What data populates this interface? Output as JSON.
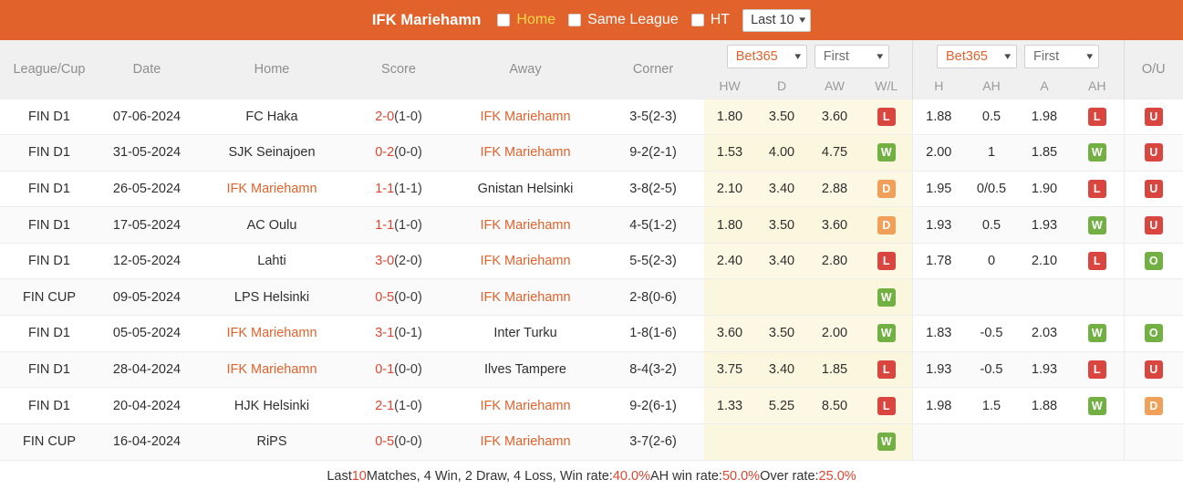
{
  "topbar": {
    "team_title": "IFK Mariehamn",
    "filters": [
      {
        "label": "Home",
        "checked": false,
        "active": true
      },
      {
        "label": "Same League",
        "checked": false,
        "active": false
      },
      {
        "label": "HT",
        "checked": false,
        "active": false
      }
    ],
    "range_select": {
      "value": "Last 10",
      "caret": "chevron-down-icon"
    }
  },
  "table": {
    "headers": {
      "league": "League/Cup",
      "date": "Date",
      "home": "Home",
      "score": "Score",
      "away": "Away",
      "corner": "Corner",
      "ou": "O/U"
    },
    "odds_group_1": {
      "bookmaker": "Bet365",
      "period": "First",
      "sub": [
        "HW",
        "D",
        "AW",
        "W/L"
      ]
    },
    "odds_group_2": {
      "bookmaker": "Bet365",
      "period": "First",
      "sub": [
        "H",
        "AH",
        "A",
        "AH"
      ]
    },
    "rows": [
      {
        "league": "FIN D1",
        "date": "07-06-2024",
        "home": "FC Haka",
        "home_hl": false,
        "score_main": "2-0",
        "score_ht": "(1-0)",
        "away": "IFK Mariehamn",
        "away_hl": true,
        "corner": "3-5(2-3)",
        "hw": "1.80",
        "d": "3.50",
        "aw": "3.60",
        "wl": "L",
        "h": "1.88",
        "ah1": "0.5",
        "a": "1.98",
        "ah2": "L",
        "ou": "U"
      },
      {
        "league": "FIN D1",
        "date": "31-05-2024",
        "home": "SJK Seinajoen",
        "home_hl": false,
        "score_main": "0-2",
        "score_ht": "(0-0)",
        "away": "IFK Mariehamn",
        "away_hl": true,
        "corner": "9-2(2-1)",
        "hw": "1.53",
        "d": "4.00",
        "aw": "4.75",
        "wl": "W",
        "h": "2.00",
        "ah1": "1",
        "a": "1.85",
        "ah2": "W",
        "ou": "U"
      },
      {
        "league": "FIN D1",
        "date": "26-05-2024",
        "home": "IFK Mariehamn",
        "home_hl": true,
        "score_main": "1-1",
        "score_ht": "(1-1)",
        "away": "Gnistan Helsinki",
        "away_hl": false,
        "corner": "3-8(2-5)",
        "hw": "2.10",
        "d": "3.40",
        "aw": "2.88",
        "wl": "D",
        "h": "1.95",
        "ah1": "0/0.5",
        "a": "1.90",
        "ah2": "L",
        "ou": "U"
      },
      {
        "league": "FIN D1",
        "date": "17-05-2024",
        "home": "AC Oulu",
        "home_hl": false,
        "score_main": "1-1",
        "score_ht": "(1-0)",
        "away": "IFK Mariehamn",
        "away_hl": true,
        "corner": "4-5(1-2)",
        "hw": "1.80",
        "d": "3.50",
        "aw": "3.60",
        "wl": "D",
        "h": "1.93",
        "ah1": "0.5",
        "a": "1.93",
        "ah2": "W",
        "ou": "U"
      },
      {
        "league": "FIN D1",
        "date": "12-05-2024",
        "home": "Lahti",
        "home_hl": false,
        "score_main": "3-0",
        "score_ht": "(2-0)",
        "away": "IFK Mariehamn",
        "away_hl": true,
        "corner": "5-5(2-3)",
        "hw": "2.40",
        "d": "3.40",
        "aw": "2.80",
        "wl": "L",
        "h": "1.78",
        "ah1": "0",
        "a": "2.10",
        "ah2": "L",
        "ou": "O"
      },
      {
        "league": "FIN CUP",
        "date": "09-05-2024",
        "home": "LPS Helsinki",
        "home_hl": false,
        "score_main": "0-5",
        "score_ht": "(0-0)",
        "away": "IFK Mariehamn",
        "away_hl": true,
        "corner": "2-8(0-6)",
        "hw": "",
        "d": "",
        "aw": "",
        "wl": "W",
        "h": "",
        "ah1": "",
        "a": "",
        "ah2": "",
        "ou": ""
      },
      {
        "league": "FIN D1",
        "date": "05-05-2024",
        "home": "IFK Mariehamn",
        "home_hl": true,
        "score_main": "3-1",
        "score_ht": "(0-1)",
        "away": "Inter Turku",
        "away_hl": false,
        "corner": "1-8(1-6)",
        "hw": "3.60",
        "d": "3.50",
        "aw": "2.00",
        "wl": "W",
        "h": "1.83",
        "ah1": "-0.5",
        "a": "2.03",
        "ah2": "W",
        "ou": "O"
      },
      {
        "league": "FIN D1",
        "date": "28-04-2024",
        "home": "IFK Mariehamn",
        "home_hl": true,
        "score_main": "0-1",
        "score_ht": "(0-0)",
        "away": "Ilves Tampere",
        "away_hl": false,
        "corner": "8-4(3-2)",
        "hw": "3.75",
        "d": "3.40",
        "aw": "1.85",
        "wl": "L",
        "h": "1.93",
        "ah1": "-0.5",
        "a": "1.93",
        "ah2": "L",
        "ou": "U"
      },
      {
        "league": "FIN D1",
        "date": "20-04-2024",
        "home": "HJK Helsinki",
        "home_hl": false,
        "score_main": "2-1",
        "score_ht": "(1-0)",
        "away": "IFK Mariehamn",
        "away_hl": true,
        "corner": "9-2(6-1)",
        "hw": "1.33",
        "d": "5.25",
        "aw": "8.50",
        "wl": "L",
        "h": "1.98",
        "ah1": "1.5",
        "a": "1.88",
        "ah2": "W",
        "ou": "D"
      },
      {
        "league": "FIN CUP",
        "date": "16-04-2024",
        "home": "RiPS",
        "home_hl": false,
        "score_main": "0-5",
        "score_ht": "(0-0)",
        "away": "IFK Mariehamn",
        "away_hl": true,
        "corner": "3-7(2-6)",
        "hw": "",
        "d": "",
        "aw": "",
        "wl": "W",
        "h": "",
        "ah1": "",
        "a": "",
        "ah2": "",
        "ou": ""
      }
    ]
  },
  "footer": {
    "p1": "Last ",
    "count": "10",
    "p2": " Matches, 4 Win, 2 Draw, 4 Loss, Win rate: ",
    "win_rate": "40.0%",
    "p3": " AH win rate: ",
    "ah_win_rate": "50.0%",
    "p4": " Over rate: ",
    "over_rate": "25.0%"
  },
  "colors": {
    "brand_orange": "#e2622c",
    "score_red": "#e0452f",
    "win_green": "#72b043",
    "loss_red": "#d9453f",
    "draw_orange": "#f0a058",
    "highlight_yellow": "#fdf8e3"
  }
}
